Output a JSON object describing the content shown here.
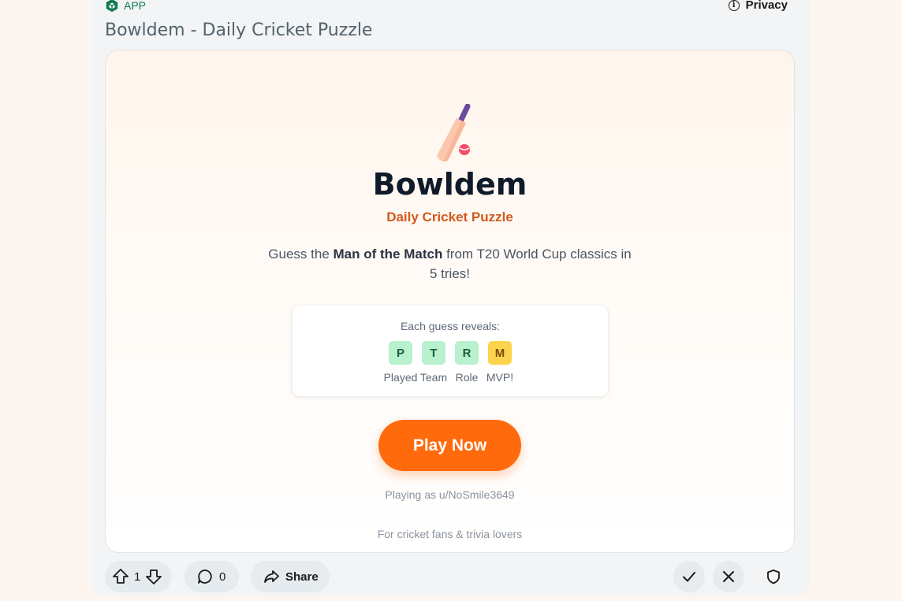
{
  "header": {
    "app_badge": "APP",
    "privacy_label": "Privacy"
  },
  "post": {
    "title": "Bowldem - Daily Cricket Puzzle"
  },
  "game": {
    "title": "Bowldem",
    "subtitle": "Daily Cricket Puzzle",
    "desc_pre": "Guess the ",
    "desc_bold": "Man of the Match",
    "desc_post": " from T20 World Cup classics in 5 tries!",
    "reveal_label": "Each guess reveals:",
    "chips": [
      {
        "letter": "P",
        "caption": "Played",
        "color": "#b9f0cd",
        "text_color": "#17603a"
      },
      {
        "letter": "T",
        "caption": "Team",
        "color": "#b9f0cd",
        "text_color": "#17603a"
      },
      {
        "letter": "R",
        "caption": "Role",
        "color": "#b9f0cd",
        "text_color": "#17603a"
      },
      {
        "letter": "M",
        "caption": "MVP!",
        "color": "#fcd34d",
        "text_color": "#7a4a08"
      }
    ],
    "play_button": "Play Now",
    "playing_as": "Playing as u/NoSmile3649",
    "footer_note": "For cricket fans & trivia lovers"
  },
  "actions": {
    "vote_count": "1",
    "comment_count": "0",
    "share_label": "Share"
  },
  "colors": {
    "accent": "#ff6a0d",
    "subtitle": "#d4581b",
    "app_green": "#0d7a52"
  },
  "icons": [
    "app-icon",
    "info-icon",
    "cricket-bat-icon",
    "upvote-icon",
    "downvote-icon",
    "comment-icon",
    "share-icon",
    "approve-check-icon",
    "remove-x-icon",
    "shield-icon"
  ]
}
